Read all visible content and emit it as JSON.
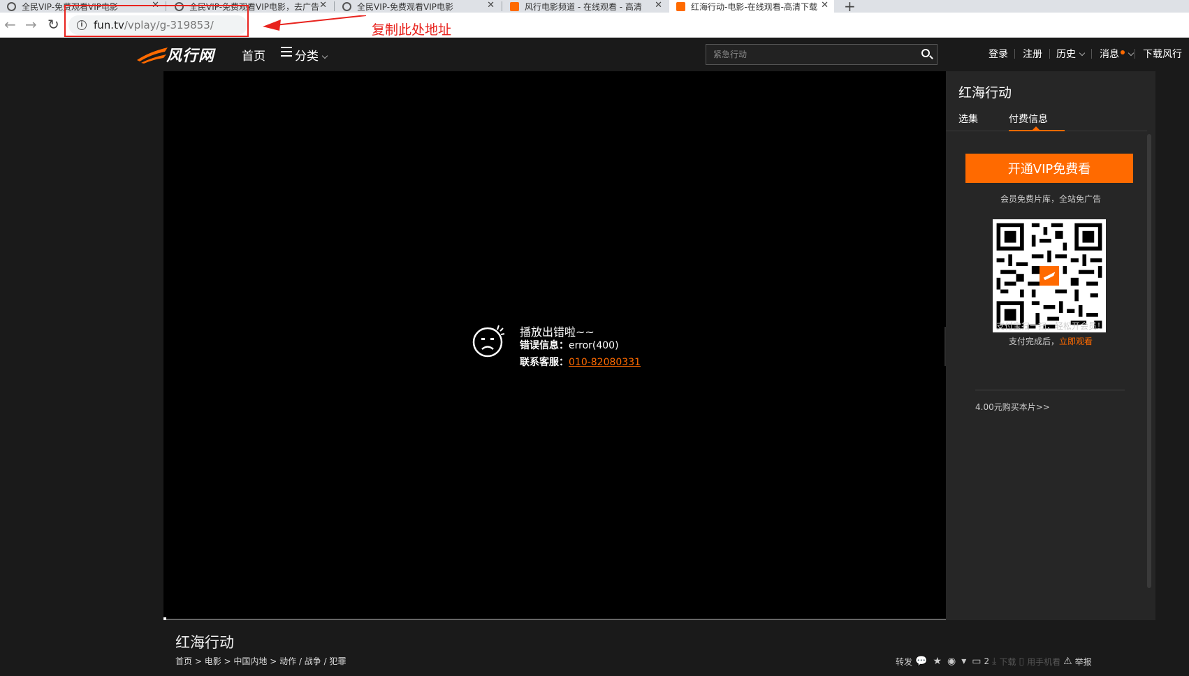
{
  "browser": {
    "tabs": [
      {
        "title": "全民VIP-免费观看VIP电影",
        "active": false
      },
      {
        "title": "全民VIP-免费观看VIP电影，去广告",
        "active": false
      },
      {
        "title": "全民VIP-免费观看VIP电影",
        "active": false
      },
      {
        "title": "风行电影频道 - 在线观看 - 高清",
        "active": false
      },
      {
        "title": "红海行动-电影-在线观看-高清下载",
        "active": true
      }
    ],
    "url_host": "fun.tv",
    "url_path": "/vplay/g-319853/",
    "annotation_text": "复制此处地址"
  },
  "header": {
    "logo_text": "风行网",
    "nav_home": "首页",
    "nav_category": "分类",
    "search_placeholder": "紧急行动",
    "login": "登录",
    "register": "注册",
    "history": "历史",
    "messages": "消息",
    "download": "下载风行"
  },
  "player": {
    "error_title": "播放出错啦~~",
    "error_info_label": "错误信息：",
    "error_info_value": "error(400)",
    "contact_label": "联系客服：",
    "contact_phone": "010-82080331"
  },
  "side": {
    "title": "红海行动",
    "tab_episodes": "选集",
    "tab_payment": "付费信息",
    "vip_button": "开通VIP免费看",
    "vip_sub": "会员免费片库，全站免广告",
    "qr_note_1": "支付宝扫一扫，轻松开会员！",
    "qr_note_2_prefix": "支付完成后，",
    "qr_note_2_link": "立即观看",
    "buy_link": "4.00元购买本片>>"
  },
  "below": {
    "title": "红海行动",
    "breadcrumb": [
      "首页",
      "电影",
      "中国内地",
      "动作",
      "战争",
      "犯罪"
    ],
    "share": "转发",
    "comments": "2",
    "download": "下载",
    "phone_watch": "用手机看",
    "report": "举报"
  },
  "colors": {
    "accent": "#ff6a00",
    "annotation": "#e8231e"
  }
}
